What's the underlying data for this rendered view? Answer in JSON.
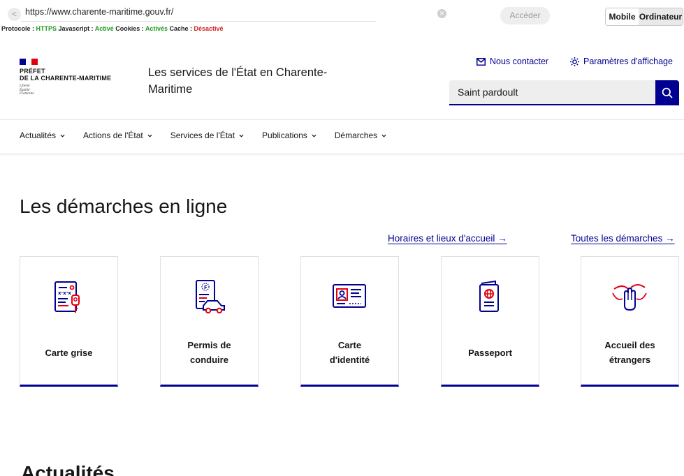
{
  "browser": {
    "back_glyph": "<",
    "url": "https://www.charente-maritime.gouv.fr/",
    "protocol_label": "Protocole : ",
    "protocol_value": "HTTPS",
    "js_label": "  Javascript : ",
    "js_value": "Activé",
    "cookies_label": "  Cookies : ",
    "cookies_value": "Activés",
    "cache_label": "  Cache : ",
    "cache_value": "Désactivé",
    "go_button": "Accéder",
    "mode_mobile": "Mobile",
    "mode_desktop": "Ordinateur"
  },
  "header": {
    "marianne_lines": [
      "PRÉFET",
      "DE LA CHARENTE-MARITIME"
    ],
    "devise_lines": [
      "Liberté",
      "Égalité",
      "Fraternité"
    ],
    "service_title": "Les services de l'État en Charente-Maritime",
    "contact_label": "Nous contacter",
    "display_settings_label": "Paramètres d'affichage",
    "search_value": "Saint pardoult"
  },
  "nav": {
    "items": [
      {
        "label": "Actualités"
      },
      {
        "label": "Actions de l'État"
      },
      {
        "label": "Services de l'État"
      },
      {
        "label": "Publications"
      },
      {
        "label": "Démarches"
      }
    ]
  },
  "demarches": {
    "title": "Les démarches en ligne",
    "link_horaires": "Horaires et lieux d'accueil →",
    "link_toutes": "Toutes les démarches →",
    "cards": [
      {
        "label": "Carte grise",
        "icon": "vehicle-registration-icon"
      },
      {
        "label": "Permis de\nconduire",
        "icon": "driving-licence-icon"
      },
      {
        "label": "Carte\nd'identité",
        "icon": "id-card-icon"
      },
      {
        "label": "Passeport",
        "icon": "passport-icon"
      },
      {
        "label": "Accueil des\nétrangers",
        "icon": "foreigners-welcome-icon"
      }
    ]
  },
  "actualites": {
    "title": "Actualités"
  },
  "colors": {
    "primary_blue": "#000091",
    "marianne_red": "#e1000f",
    "status_ok": "#1f9b1f",
    "status_ko": "#d0201b"
  }
}
